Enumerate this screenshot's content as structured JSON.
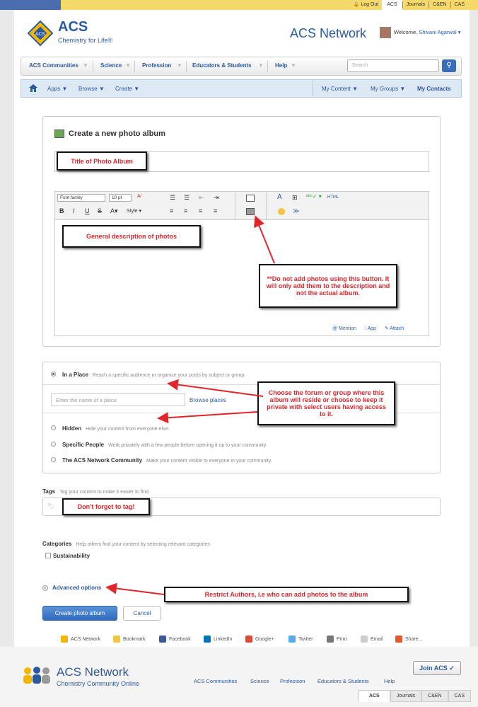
{
  "topbar": {
    "links": [
      "Log Out",
      "ACS",
      "Journals",
      "C&EN",
      "CAS"
    ]
  },
  "header": {
    "logo_text": "ACS",
    "logo_tagline": "Chemistry for Life®",
    "site_title": "ACS Network",
    "welcome_prefix": "Welcome,",
    "user_name": "Shivani Agarwal ▾"
  },
  "mainnav": {
    "items": [
      "ACS Communities",
      "Science",
      "Profession",
      "Educators & Students",
      "Help"
    ],
    "search_placeholder": "Search"
  },
  "subnav": {
    "left": [
      "Apps ▼",
      "Browse ▼",
      "Create ▼"
    ],
    "right": [
      "My Content ▼",
      "My Groups ▼",
      "My Contacts"
    ]
  },
  "form": {
    "title": "Create a new photo album",
    "editor": {
      "font_family": "Font family",
      "font_size": "10 pt",
      "style": "Style",
      "html": "HTML",
      "footer_links": [
        "@ Mention",
        "App",
        "Attach"
      ]
    },
    "visibility": {
      "in_place_label": "In a Place",
      "in_place_desc": "Reach a specific audience or organize your posts by subject or group.",
      "place_placeholder": "Enter the name of a place",
      "browse_places": "Browse places",
      "hidden_label": "Hidden",
      "hidden_desc": "Hide your content from everyone else.",
      "specific_label": "Specific People",
      "specific_desc": "Work privately with a few people before opening it up to your community.",
      "community_label": "The ACS Network Community",
      "community_desc": "Make your content visible to everyone in your community."
    },
    "tags_label": "Tags",
    "tags_desc": "Tag your content to make it easier to find",
    "categories_label": "Categories",
    "categories_desc": "Help others find your content by selecting relevant categories",
    "category_sustainability": "Sustainability",
    "advanced_options": "Advanced options",
    "create_button": "Create photo album",
    "cancel_button": "Cancel"
  },
  "callouts": {
    "title": "Title of Photo Album",
    "description": "General description of photos",
    "photo_warning": "**Do not add photos using this button. It will only add them to the description and not the actual album.",
    "place": "Choose the forum or group where this album will reside or choose to keep it private with select users having access to it.",
    "tag": "Don't forget to tag!",
    "advanced": "Restrict Authors, i.e who can add photos to the album"
  },
  "share": [
    "ACS Network",
    "Bookmark",
    "Facebook",
    "LinkedIn",
    "Google+",
    "Twitter",
    "Print",
    "Email",
    "Share..."
  ],
  "footer": {
    "title": "ACS Network",
    "subtitle": "Chemistry Community Online",
    "links": [
      "ACS Communities",
      "Science",
      "Profession",
      "Educators & Students",
      "Help"
    ],
    "join": "Join ACS ✓",
    "tabs": [
      "ACS",
      "Journals",
      "C&EN",
      "CAS"
    ]
  },
  "colors": {
    "brand_blue": "#2c5aa0",
    "callout_red": "#e0262b",
    "gold_bar": "#f5d96a"
  }
}
